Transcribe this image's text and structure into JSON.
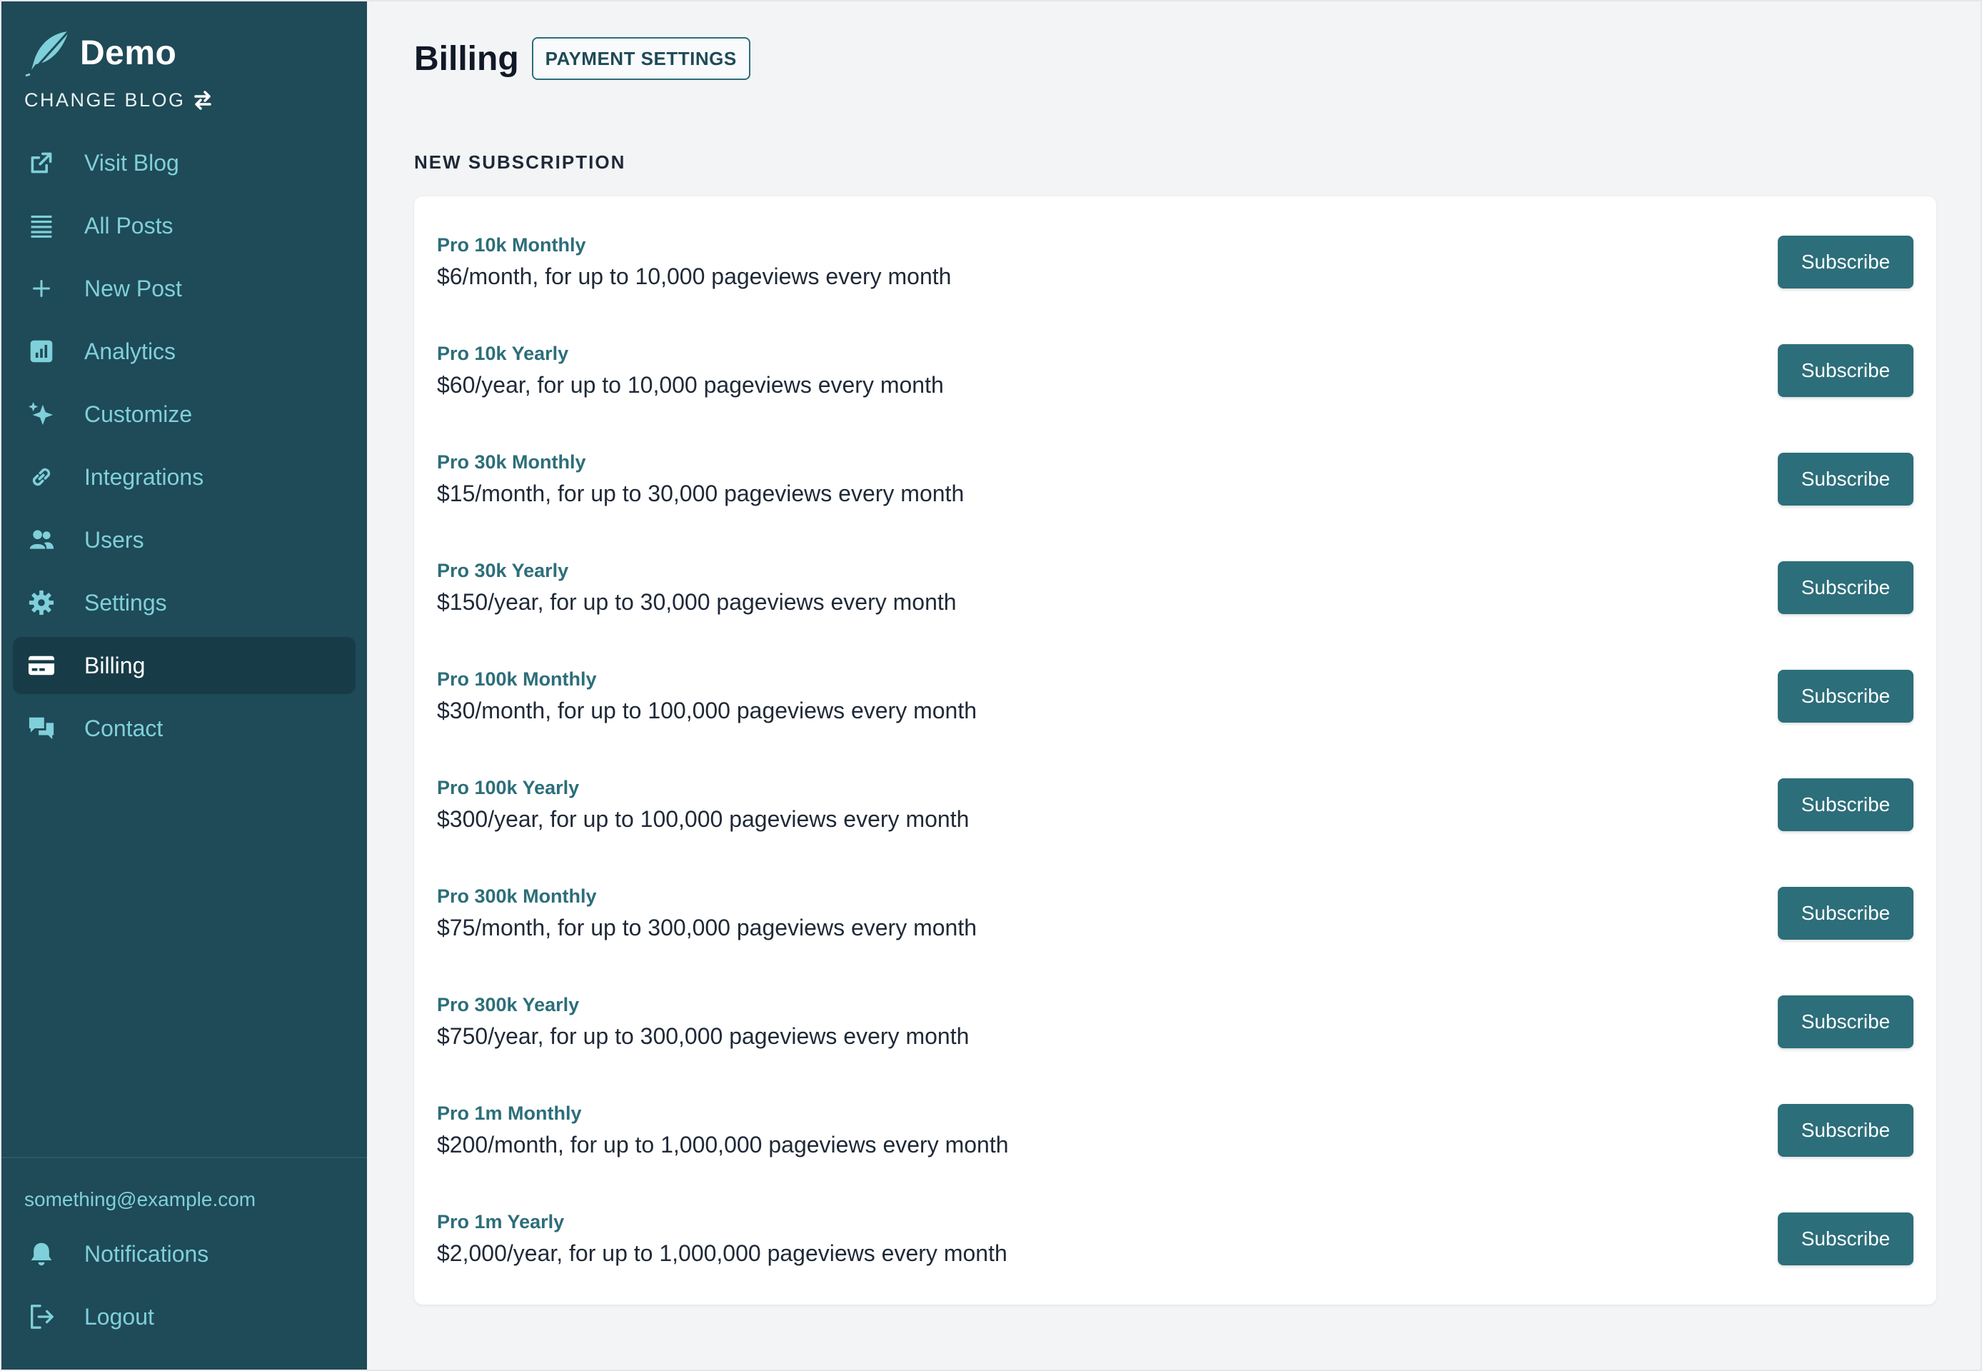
{
  "brand": {
    "name": "Demo",
    "change_blog": "CHANGE BLOG"
  },
  "nav": [
    {
      "label": "Visit Blog",
      "icon": "external-link-icon"
    },
    {
      "label": "All Posts",
      "icon": "list-icon"
    },
    {
      "label": "New Post",
      "icon": "plus-icon"
    },
    {
      "label": "Analytics",
      "icon": "chart-icon"
    },
    {
      "label": "Customize",
      "icon": "sparkles-icon"
    },
    {
      "label": "Integrations",
      "icon": "link-icon"
    },
    {
      "label": "Users",
      "icon": "users-icon"
    },
    {
      "label": "Settings",
      "icon": "gear-icon"
    },
    {
      "label": "Billing",
      "icon": "credit-card-icon",
      "active": true
    },
    {
      "label": "Contact",
      "icon": "chat-icon"
    }
  ],
  "footer": {
    "email": "something@example.com",
    "notifications": "Notifications",
    "logout": "Logout"
  },
  "header": {
    "title": "Billing",
    "payment_settings": "PAYMENT SETTINGS"
  },
  "section_label": "NEW SUBSCRIPTION",
  "subscribe_label": "Subscribe",
  "plans": [
    {
      "name": "Pro 10k Monthly",
      "desc": "$6/month, for up to 10,000 pageviews every month",
      "button": "Subscribe"
    },
    {
      "name": "Pro 10k Yearly",
      "desc": "$60/year, for up to 10,000 pageviews every month",
      "button": "Subscribe"
    },
    {
      "name": "Pro 30k Monthly",
      "desc": "$15/month, for up to 30,000 pageviews every month",
      "button": "Subscribe"
    },
    {
      "name": "Pro 30k Yearly",
      "desc": "$150/year, for up to 30,000 pageviews every month",
      "button": "Subscribe"
    },
    {
      "name": "Pro 100k Monthly",
      "desc": "$30/month, for up to 100,000 pageviews every month",
      "button": "Subscribe"
    },
    {
      "name": "Pro 100k Yearly",
      "desc": "$300/year, for up to 100,000 pageviews every month",
      "button": "Subscribe"
    },
    {
      "name": "Pro 300k Monthly",
      "desc": "$75/month, for up to 300,000 pageviews every month",
      "button": "Subscribe"
    },
    {
      "name": "Pro 300k Yearly",
      "desc": "$750/year, for up to 300,000 pageviews every month",
      "button": "Subscribe"
    },
    {
      "name": "Pro 1m Monthly",
      "desc": "$200/month, for up to 1,000,000 pageviews every month",
      "button": "Subscribe"
    },
    {
      "name": "Pro 1m Yearly",
      "desc": "$2,000/year, for up to 1,000,000 pageviews every month",
      "button": "Subscribe"
    }
  ],
  "colors": {
    "sidebar_bg": "#1f4a57",
    "sidebar_active_bg": "#173c47",
    "nav_text": "#7fd0da",
    "accent": "#2c6e7a",
    "page_bg": "#f3f4f6"
  }
}
